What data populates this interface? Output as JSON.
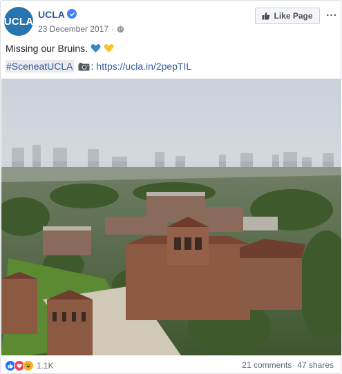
{
  "post": {
    "page_name": "UCLA",
    "avatar_text": "UCLA",
    "date": "23 December 2017",
    "date_separator": "·",
    "like_page_label": "Like Page",
    "more_label": "···",
    "line1_text": "Missing our Bruins.",
    "hashtag": "#SceneatUCLA",
    "colon": ":",
    "link": "https://ucla.in/2pepTIL",
    "reaction_count": "1.1K",
    "comments": "21 comments",
    "shares": "47 shares"
  },
  "icons": {
    "verified": "verified-badge-icon",
    "globe": "globe-icon",
    "like": "thumbs-up-icon",
    "blue_heart": "blue-heart-icon",
    "yellow_heart": "yellow-heart-icon",
    "camera": "camera-icon",
    "reactions": [
      "like-reaction-icon",
      "love-reaction-icon",
      "haha-reaction-icon"
    ]
  },
  "colors": {
    "link": "#365899",
    "avatar_bg": "#2774ae",
    "verified": "#4080ff",
    "blue_heart": "#3b88c3",
    "yellow_heart": "#f4c430"
  }
}
